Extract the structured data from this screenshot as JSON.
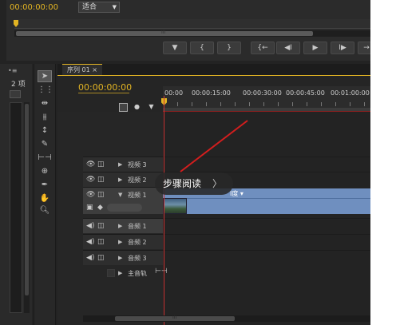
{
  "monitor": {
    "timecode": "00:00:00:00",
    "fit_label": "适合",
    "transport_buttons": [
      "▼",
      "{",
      "}",
      "{←",
      "◀I",
      "▶",
      "I▶",
      "→"
    ],
    "grip": "III"
  },
  "project": {
    "count_label": "2 项"
  },
  "sequence": {
    "tab_label": "序列 01 ×",
    "timecode": "00:00:00:00",
    "ruler_labels": [
      "00:00",
      "00:00:15:00",
      "00:00:30:00",
      "00:00:45:00",
      "00:01:00:00"
    ],
    "clip_label": "I度 ▾"
  },
  "tracks": [
    {
      "name": "视频 3",
      "eye": "👁",
      "lock": "◫",
      "collapsed": true
    },
    {
      "name": "视频 2",
      "eye": "👁",
      "lock": "◫",
      "collapsed": true
    },
    {
      "name": "视频 1",
      "eye": "👁",
      "lock": "◫",
      "collapsed": false
    },
    {
      "name": "音频 1",
      "eye": "◀)",
      "lock": "◫",
      "collapsed": true
    },
    {
      "name": "音频 2",
      "eye": "◀)",
      "lock": "◫",
      "collapsed": true
    },
    {
      "name": "音频 3",
      "eye": "◀)",
      "lock": "◫",
      "collapsed": true
    },
    {
      "name": "主音轨",
      "eye": "",
      "lock": "",
      "collapsed": true
    }
  ],
  "popup": {
    "label": "步骤阅读",
    "chevron": "〉"
  },
  "colors": {
    "accent": "#e2b423",
    "playhead": "#c83232",
    "clip": "#6f8fbf",
    "annotation_arrow": "#d21e1e"
  }
}
